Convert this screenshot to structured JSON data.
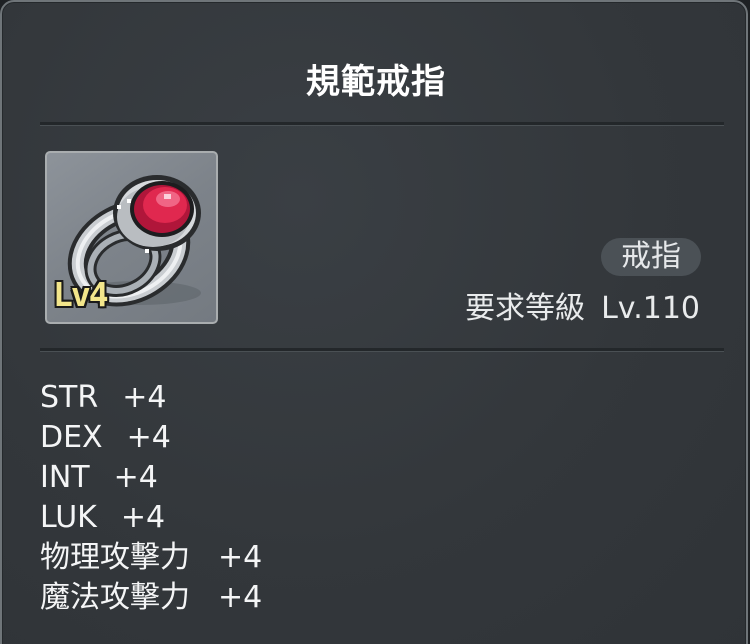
{
  "item": {
    "name": "規範戒指",
    "level_badge": "Lv4",
    "category": "戒指",
    "required_level_label": "要求等級",
    "required_level_value": "Lv.110",
    "icon": "ruby-ring-icon"
  },
  "stats": [
    {
      "label": "STR",
      "value": "+4"
    },
    {
      "label": "DEX",
      "value": "+4"
    },
    {
      "label": "INT",
      "value": "+4"
    },
    {
      "label": "LUK",
      "value": "+4"
    },
    {
      "label": "物理攻擊力",
      "value": "+4"
    },
    {
      "label": "魔法攻擊力",
      "value": "+4"
    }
  ],
  "colors": {
    "panel_bg": "#33373b",
    "title": "#ffffff",
    "gem": "#e0284f",
    "badge_text": "#f3e68b"
  }
}
